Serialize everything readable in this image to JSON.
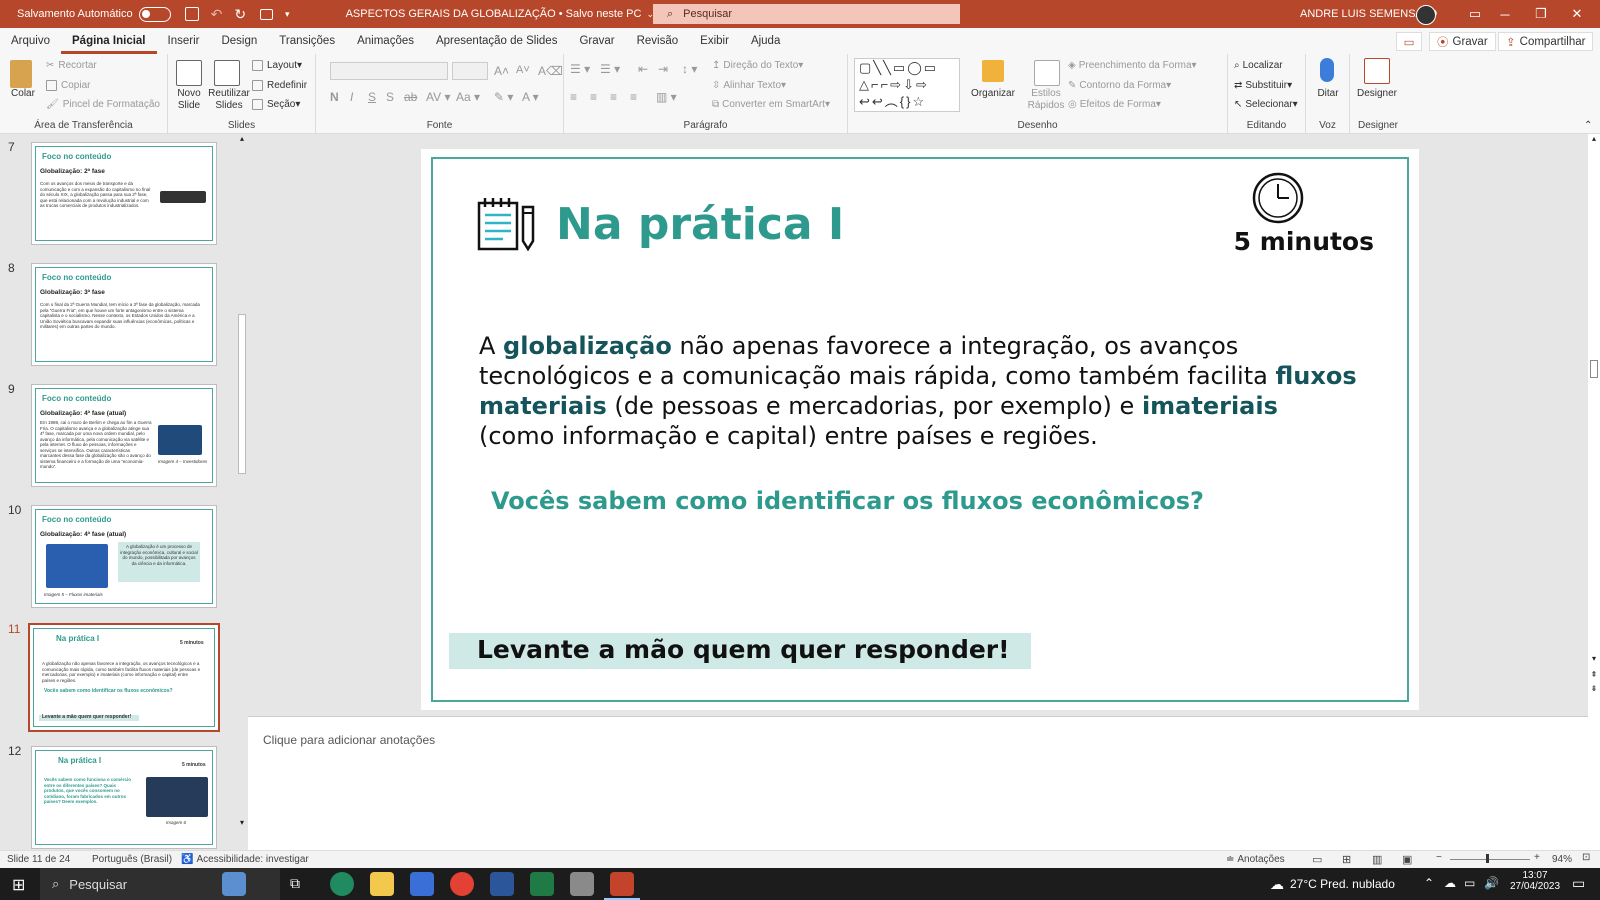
{
  "titlebar": {
    "autosave_label": "Salvamento Automático",
    "doc_title": "ASPECTOS GERAIS DA GLOBALIZAÇÃO • Salvo neste PC",
    "search_placeholder": "Pesquisar",
    "user_name": "ANDRE LUIS SEMENSATO"
  },
  "menu": {
    "tabs": [
      "Arquivo",
      "Página Inicial",
      "Inserir",
      "Design",
      "Transições",
      "Animações",
      "Apresentação de Slides",
      "Gravar",
      "Revisão",
      "Exibir",
      "Ajuda"
    ],
    "record_label": "Gravar",
    "share_label": "Compartilhar"
  },
  "ribbon": {
    "clipboard": {
      "paste": "Colar",
      "cut": "Recortar",
      "copy": "Copiar",
      "format_painter": "Pincel de Formatação",
      "label": "Área de Transferência"
    },
    "slides": {
      "new_slide": "Novo\nSlide",
      "reuse": "Reutilizar\nSlides",
      "layout": "Layout",
      "reset": "Redefinir",
      "section": "Seção",
      "label": "Slides"
    },
    "font": {
      "label": "Fonte"
    },
    "paragraph": {
      "text_direction": "Direção do Texto",
      "align_text": "Alinhar Texto",
      "smartart": "Converter em SmartArt",
      "label": "Parágrafo"
    },
    "drawing": {
      "arrange": "Organizar",
      "quick_styles": "Estilos\nRápidos",
      "shape_fill": "Preenchimento da Forma",
      "shape_outline": "Contorno da Forma",
      "shape_effects": "Efeitos de Forma",
      "label": "Desenho"
    },
    "editing": {
      "find": "Localizar",
      "replace": "Substituir",
      "select": "Selecionar",
      "label": "Editando"
    },
    "voice": {
      "dictate": "Ditar",
      "label": "Voz"
    },
    "designer": {
      "designer": "Designer",
      "label": "Designer"
    }
  },
  "thumbnails": [
    {
      "num": "7",
      "title": "Foco no conteúdo",
      "subtitle": "Globalização: 2ª fase",
      "text": "Com os avanços dos meios de transporte e da comunicação e com a expansão do capitalismo no final do século XIX, a globalização passa para sua 2ª fase, que está relacionada com a revolução industrial e com as trocas comerciais de produtos industrializados."
    },
    {
      "num": "8",
      "title": "Foco no conteúdo",
      "subtitle": "Globalização: 3ª fase",
      "text": "Com o final da 2ª Guerra Mundial, tem início a 3ª fase da globalização, marcada pela “Guerra Fria”, em que houve um forte antagonismo entre o sistema capitalista e o socialismo. Nesse contexto, os Estados Unidos da América e a União Soviética buscavam expandir suas influências (econômicas, políticas e militares) em outras partes do mundo."
    },
    {
      "num": "9",
      "title": "Foco no conteúdo",
      "subtitle": "Globalização: 4ª fase (atual)",
      "text": "Em 1989, cai o muro de Berlim e chega ao fim a Guerra Fria. O capitalismo avança e a globalização atinge sua 4ª fase, marcada por uma nova ordem mundial, pelo avanço da informática, pela comunicação via satélite e pela internet. O fluxo de pessoas, informações e serviços se intensifica. Outras características marcantes dessa fase da globalização são o avanço do sistema financeiro e a formação de uma “economia-mundo”.",
      "caption": "Imagem 4 – Investidores"
    },
    {
      "num": "10",
      "title": "Foco no conteúdo",
      "subtitle": "Globalização: 4ª fase (atual)",
      "text": "A globalização é um processo de integração econômica, cultural e social do mundo, possibilitada por avanços da ciência e da informática.",
      "caption": "Imagem 5 – Fluxos imateriais"
    },
    {
      "num": "11",
      "title": "Na prática I",
      "subtitle": "",
      "text": "A globalização não apenas favorece a integração, os avanços tecnológicos e a comunicação mais rápida, como também facilita fluxos materiais (de pessoas e mercadorias, por exemplo) e imateriais (como informação e capital) entre países e regiões.",
      "question": "Vocês sabem como identificar os fluxos econômicos?",
      "banner": "Levante a mão quem quer responder!",
      "time": "5 minutos"
    },
    {
      "num": "12",
      "title": "Na prática I",
      "subtitle": "",
      "text": "Vocês sabem como funciona o comércio entre os diferentes países? Quais produtos, que vocês consomem no cotidiano, foram fabricados em outros países? Deem exemplos.",
      "time": "5 minutos",
      "caption": "Imagem 6"
    }
  ],
  "slide": {
    "title": "Na prática I",
    "time_label": "5 minutos",
    "body_parts": [
      "A ",
      "globalização",
      " não apenas favorece a integração, os avanços tecnológicos e a comunicação mais rápida, como também facilita ",
      "fluxos materiais",
      " (de pessoas e mercadorias, por exemplo) e ",
      "imateriais",
      " (como informação e capital) entre países e regiões."
    ],
    "question": "Vocês sabem como identificar os fluxos econômicos?",
    "banner": "Levante a mão quem quer responder!"
  },
  "notes_placeholder": "Clique para adicionar anotações",
  "status": {
    "slide_count": "Slide 11 de 24",
    "language": "Português (Brasil)",
    "accessibility": "Acessibilidade: investigar",
    "notes_btn": "Anotações",
    "zoom": "94%"
  },
  "taskbar": {
    "search_placeholder": "Pesquisar",
    "weather": "27°C  Pred. nublado",
    "time": "13:07",
    "date": "27/04/2023"
  },
  "colors": {
    "accent": "#b7472a",
    "teal": "#2e9a8e",
    "dark_teal": "#14545a",
    "banner": "#cfeae6"
  }
}
